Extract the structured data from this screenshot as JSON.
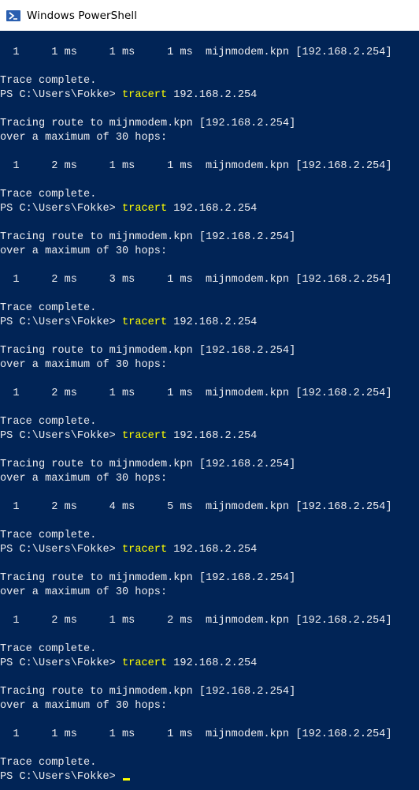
{
  "window": {
    "title": "Windows PowerShell",
    "icon": "powershell-icon",
    "colors": {
      "console_background": "#012456",
      "console_text": "#eeedf0",
      "command_text": "#ffff00",
      "titlebar_background": "#ffffff"
    }
  },
  "console": {
    "lines": [
      {
        "text": "  1     1 ms     1 ms     1 ms  mijnmodem.kpn [192.168.2.254]"
      },
      {
        "text": ""
      },
      {
        "text": "Trace complete."
      },
      {
        "prompt": "PS C:\\Users\\Fokke> ",
        "command": "tracert",
        "args": " 192.168.2.254"
      },
      {
        "text": ""
      },
      {
        "text": "Tracing route to mijnmodem.kpn [192.168.2.254]"
      },
      {
        "text": "over a maximum of 30 hops:"
      },
      {
        "text": ""
      },
      {
        "text": "  1     2 ms     1 ms     1 ms  mijnmodem.kpn [192.168.2.254]"
      },
      {
        "text": ""
      },
      {
        "text": "Trace complete."
      },
      {
        "prompt": "PS C:\\Users\\Fokke> ",
        "command": "tracert",
        "args": " 192.168.2.254"
      },
      {
        "text": ""
      },
      {
        "text": "Tracing route to mijnmodem.kpn [192.168.2.254]"
      },
      {
        "text": "over a maximum of 30 hops:"
      },
      {
        "text": ""
      },
      {
        "text": "  1     2 ms     3 ms     1 ms  mijnmodem.kpn [192.168.2.254]"
      },
      {
        "text": ""
      },
      {
        "text": "Trace complete."
      },
      {
        "prompt": "PS C:\\Users\\Fokke> ",
        "command": "tracert",
        "args": " 192.168.2.254"
      },
      {
        "text": ""
      },
      {
        "text": "Tracing route to mijnmodem.kpn [192.168.2.254]"
      },
      {
        "text": "over a maximum of 30 hops:"
      },
      {
        "text": ""
      },
      {
        "text": "  1     2 ms     1 ms     1 ms  mijnmodem.kpn [192.168.2.254]"
      },
      {
        "text": ""
      },
      {
        "text": "Trace complete."
      },
      {
        "prompt": "PS C:\\Users\\Fokke> ",
        "command": "tracert",
        "args": " 192.168.2.254"
      },
      {
        "text": ""
      },
      {
        "text": "Tracing route to mijnmodem.kpn [192.168.2.254]"
      },
      {
        "text": "over a maximum of 30 hops:"
      },
      {
        "text": ""
      },
      {
        "text": "  1     2 ms     4 ms     5 ms  mijnmodem.kpn [192.168.2.254]"
      },
      {
        "text": ""
      },
      {
        "text": "Trace complete."
      },
      {
        "prompt": "PS C:\\Users\\Fokke> ",
        "command": "tracert",
        "args": " 192.168.2.254"
      },
      {
        "text": ""
      },
      {
        "text": "Tracing route to mijnmodem.kpn [192.168.2.254]"
      },
      {
        "text": "over a maximum of 30 hops:"
      },
      {
        "text": ""
      },
      {
        "text": "  1     2 ms     1 ms     2 ms  mijnmodem.kpn [192.168.2.254]"
      },
      {
        "text": ""
      },
      {
        "text": "Trace complete."
      },
      {
        "prompt": "PS C:\\Users\\Fokke> ",
        "command": "tracert",
        "args": " 192.168.2.254"
      },
      {
        "text": ""
      },
      {
        "text": "Tracing route to mijnmodem.kpn [192.168.2.254]"
      },
      {
        "text": "over a maximum of 30 hops:"
      },
      {
        "text": ""
      },
      {
        "text": "  1     1 ms     1 ms     1 ms  mijnmodem.kpn [192.168.2.254]"
      },
      {
        "text": ""
      },
      {
        "text": "Trace complete."
      },
      {
        "prompt": "PS C:\\Users\\Fokke> ",
        "command": "",
        "args": "",
        "cursor": true
      }
    ]
  }
}
